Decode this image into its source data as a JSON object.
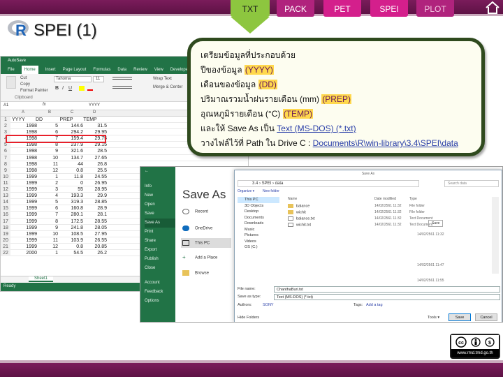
{
  "nav_tabs": [
    {
      "label": "TXT"
    },
    {
      "label": "PACK"
    },
    {
      "label": "PET"
    },
    {
      "label": "SPEI"
    },
    {
      "label": "PLOT"
    }
  ],
  "title": "SPEI (1)",
  "colors": {
    "band": "#6b1650",
    "active_tab": "#8dc63f",
    "tab": "#d41f8c",
    "highlight": "#ffd84d",
    "callout_border": "#2f4a1e"
  },
  "excel": {
    "autosave": "AutoSave",
    "menu": [
      "File",
      "Home",
      "Insert",
      "Page Layout",
      "Formulas",
      "Data",
      "Review",
      "View",
      "Developer"
    ],
    "ribbon": {
      "cut": "Cut",
      "copy": "Copy",
      "format_painter": "Format Painter",
      "clipboard": "Clipboard",
      "font": "Tahoma",
      "font_size": "11",
      "wrap_text": "Wrap Text",
      "merge": "Merge & Center"
    },
    "formula_cell": "A1",
    "formula_value": "YYYY",
    "columns": [
      "A",
      "B",
      "C",
      "D"
    ],
    "header": {
      "row": "1",
      "yyyy": "YYYY",
      "dd": "DD",
      "prep": "PREP",
      "temp": "TEMP"
    },
    "rows": [
      {
        "n": "2",
        "y": "1998",
        "m": "5",
        "p": "144.6",
        "t": "31.5"
      },
      {
        "n": "3",
        "y": "1998",
        "m": "6",
        "p": "294.2",
        "t": "29.95"
      },
      {
        "n": "4",
        "y": "1998",
        "m": "7",
        "p": "159.4",
        "t": "29.75"
      },
      {
        "n": "5",
        "y": "1998",
        "m": "8",
        "p": "237.9",
        "t": "29.15"
      },
      {
        "n": "6",
        "y": "1998",
        "m": "9",
        "p": "321.6",
        "t": "28.5"
      },
      {
        "n": "7",
        "y": "1998",
        "m": "10",
        "p": "134.7",
        "t": "27.65"
      },
      {
        "n": "8",
        "y": "1998",
        "m": "11",
        "p": "44",
        "t": "26.8"
      },
      {
        "n": "9",
        "y": "1998",
        "m": "12",
        "p": "0.8",
        "t": "25.5"
      },
      {
        "n": "10",
        "y": "1999",
        "m": "1",
        "p": "11.8",
        "t": "24.55"
      },
      {
        "n": "11",
        "y": "1999",
        "m": "2",
        "p": "0",
        "t": "26.95"
      },
      {
        "n": "12",
        "y": "1999",
        "m": "3",
        "p": "55",
        "t": "28.95"
      },
      {
        "n": "13",
        "y": "1999",
        "m": "4",
        "p": "193.3",
        "t": "29.9"
      },
      {
        "n": "14",
        "y": "1999",
        "m": "5",
        "p": "319.3",
        "t": "28.85"
      },
      {
        "n": "15",
        "y": "1999",
        "m": "6",
        "p": "160.8",
        "t": "28.9"
      },
      {
        "n": "16",
        "y": "1999",
        "m": "7",
        "p": "280.1",
        "t": "28.1"
      },
      {
        "n": "17",
        "y": "1999",
        "m": "8",
        "p": "172.5",
        "t": "28.55"
      },
      {
        "n": "18",
        "y": "1999",
        "m": "9",
        "p": "241.8",
        "t": "28.05"
      },
      {
        "n": "19",
        "y": "1999",
        "m": "10",
        "p": "108.5",
        "t": "27.95"
      },
      {
        "n": "20",
        "y": "1999",
        "m": "11",
        "p": "103.9",
        "t": "26.55"
      },
      {
        "n": "21",
        "y": "1999",
        "m": "12",
        "p": "0.8",
        "t": "20.85"
      },
      {
        "n": "22",
        "y": "2000",
        "m": "1",
        "p": "54.5",
        "t": "26.2"
      }
    ],
    "sheet_tab": "Sheet1",
    "status": "Ready"
  },
  "callout": {
    "line1": "เตรียมข้อมูลที่ประกอบด้วย",
    "line2_pre": "ปีของข้อมูล",
    "line2_hl": "(YYYY)",
    "line3_pre": "เดือนของข้อมูล",
    "line3_hl": "(DD)",
    "line4_pre": "ปริมาณรวมน้ำฝนรายเดือน (mm)",
    "line4_hl": "(PREP)",
    "line5_pre": "อุณหภูมิรายเดือน (°C)",
    "line5_hl": "(TEMP)",
    "line6_pre": "และให้ Save As เป็น",
    "line6_link": "Text (MS-DOS) (*.txt)",
    "line7_pre": "วางไฟล์ไว้ที่ Path ใน Drive C :",
    "line7_link": "Documents\\R\\win-library\\3.4\\SPEI\\data"
  },
  "saveas": {
    "left_menu": [
      "Info",
      "New",
      "Open",
      "Save",
      "Save As",
      "Print",
      "Share",
      "Export",
      "Publish",
      "Close",
      "Account",
      "Feedback",
      "Options"
    ],
    "heading": "Save As",
    "locations": [
      "Recent",
      "OneDrive",
      "This PC",
      "Add a Place",
      "Browse"
    ],
    "dialog_title": "Save As",
    "address": "3.4 › SPEI › data",
    "search_placeholder": "Search data",
    "organize": "Organize ▾",
    "new_folder": "New folder",
    "nav_items": [
      "This PC",
      "3D Objects",
      "Desktop",
      "Documents",
      "Downloads",
      "Music",
      "Pictures",
      "Videos",
      "OS (C:)"
    ],
    "col_name": "Name",
    "col_date": "Date modified",
    "col_type": "Type",
    "files": [
      {
        "name": "balance",
        "date": "14/02/2561 11:32",
        "type": "File folder"
      },
      {
        "name": "wichit",
        "date": "14/02/2561 11:32",
        "type": "File folder"
      },
      {
        "name": "balance.txt",
        "date": "14/02/2561 11:32",
        "type": "Text Document"
      },
      {
        "name": "wichit.txt",
        "date": "14/02/2561 11:32",
        "type": "Text Document"
      }
    ],
    "file_name_label": "File name:",
    "file_name_value": "ChanthaBuri.txt",
    "save_type_label": "Save as type:",
    "save_type_value": "Text (MS-DOS) (*.txt)",
    "authors_label": "Authors:",
    "authors_value": "SONY",
    "tags_label": "Tags:",
    "tags_value": "Add a tag",
    "hide_folders": "Hide Folders",
    "tools": "Tools ▾",
    "save_btn": "Save",
    "cancel_btn": "Cancel",
    "side_save": "Save",
    "side_dates": [
      "14/02/2561 11:32",
      "14/02/2561 11:47",
      "14/02/2561 11:55"
    ]
  },
  "cc_badge": {
    "url": "www.rmd.tmd.go.th"
  }
}
